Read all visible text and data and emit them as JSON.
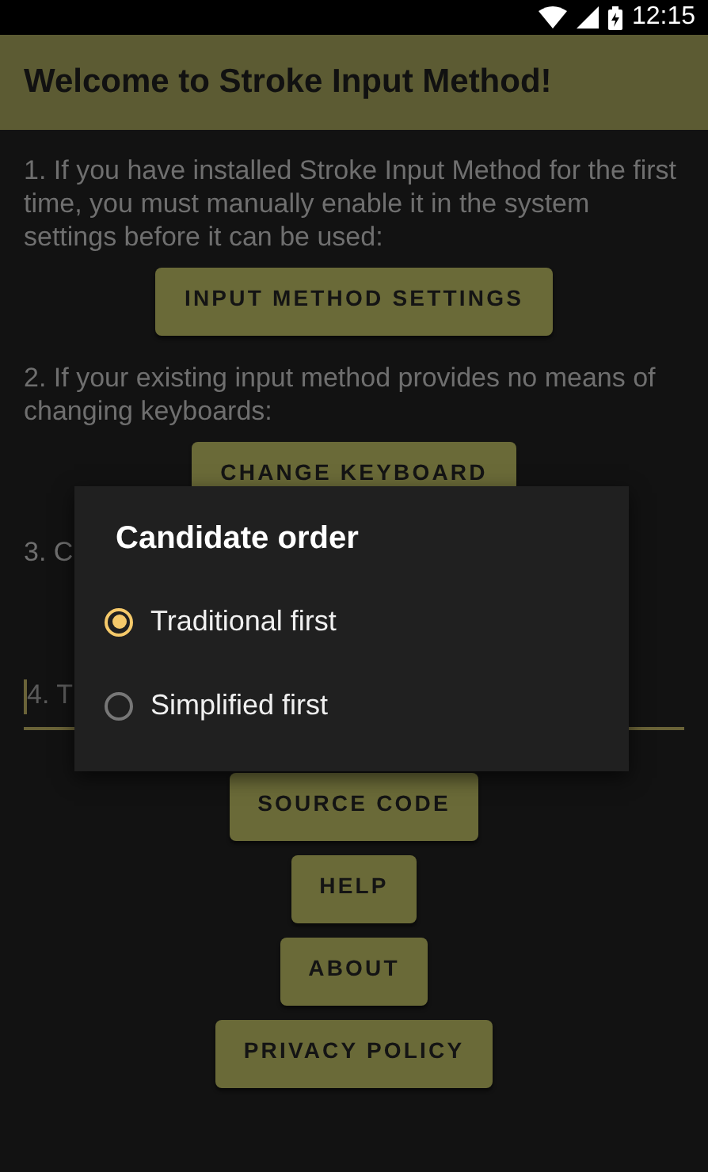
{
  "status_bar": {
    "time": "12:15"
  },
  "app_bar": {
    "title": "Welcome to Stroke Input Method!"
  },
  "content": [
    {
      "kind": "text",
      "text": "1. If you have installed Stroke Input Method for the first time, you must manually enable it in the system settings before it can be used:"
    },
    {
      "kind": "button",
      "label": "INPUT METHOD SETTINGS"
    },
    {
      "kind": "text",
      "text": "2. If your existing input method provides no means of changing keyboards:"
    },
    {
      "kind": "button",
      "label": "CHANGE KEYBOARD"
    },
    {
      "kind": "text",
      "text": "3. C"
    },
    {
      "kind": "field",
      "placeholder": "4. T"
    },
    {
      "kind": "button",
      "label": "SOURCE CODE"
    },
    {
      "kind": "button",
      "label": "HELP"
    },
    {
      "kind": "button",
      "label": "ABOUT"
    },
    {
      "kind": "button",
      "label": "PRIVACY POLICY"
    }
  ],
  "dialog": {
    "title": "Candidate order",
    "options": [
      {
        "label": "Traditional first",
        "selected": true
      },
      {
        "label": "Simplified first",
        "selected": false
      }
    ]
  }
}
